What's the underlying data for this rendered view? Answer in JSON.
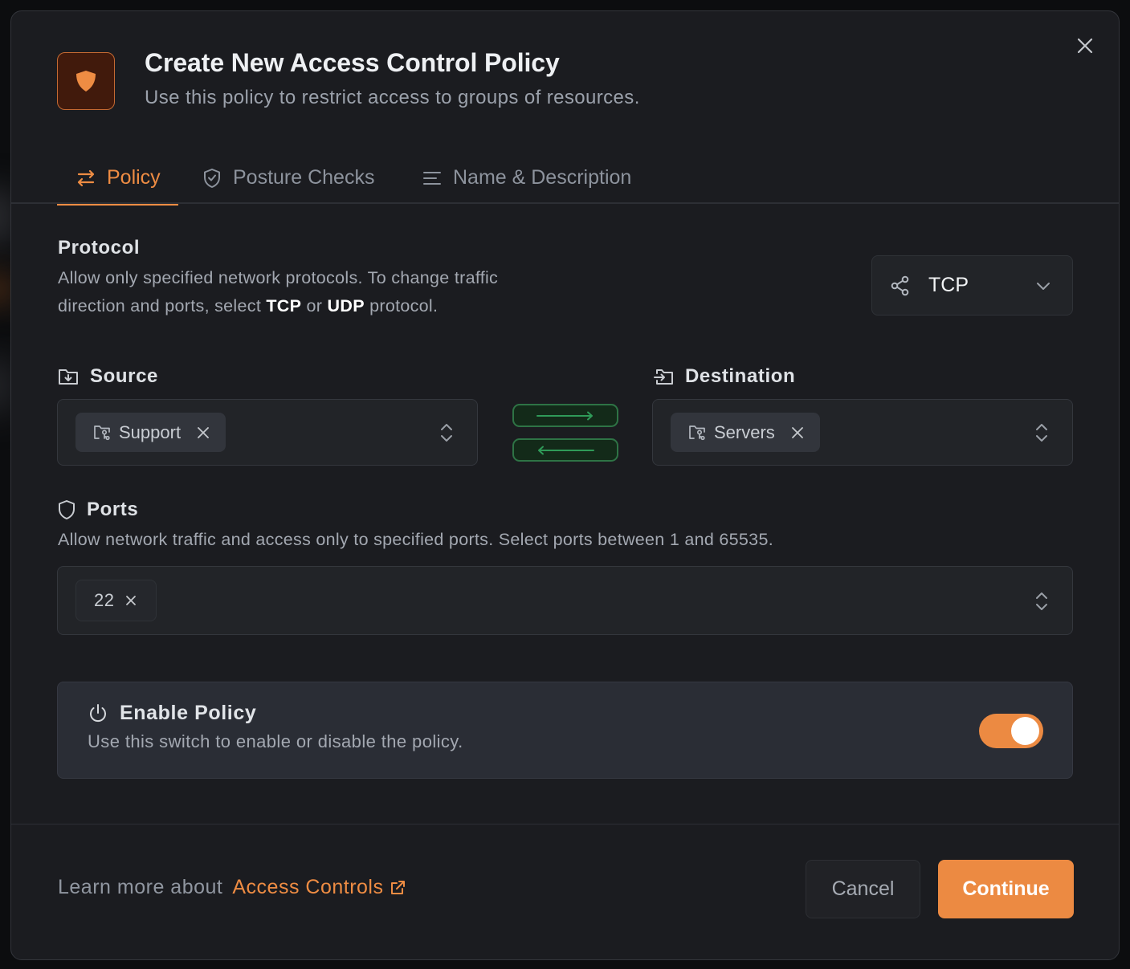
{
  "colors": {
    "accent": "#ec8a42",
    "dialog_bg": "#1b1c20",
    "direction_green": "#2e7345"
  },
  "dialog": {
    "title": "Create New Access Control Policy",
    "subtitle": "Use this policy to restrict access to groups of resources.",
    "header_icon": "shield-icon",
    "close_icon": "close-icon"
  },
  "tabs": [
    {
      "label": "Policy",
      "icon": "arrows-left-right-icon",
      "active": true
    },
    {
      "label": "Posture Checks",
      "icon": "shield-check-icon",
      "active": false
    },
    {
      "label": "Name & Description",
      "icon": "text-lines-icon",
      "active": false
    }
  ],
  "protocol": {
    "title": "Protocol",
    "desc_part1": "Allow only specified network protocols. To change traffic",
    "desc_part2": "direction and ports, select ",
    "desc_tcp": "TCP",
    "desc_or": " or ",
    "desc_udp": "UDP",
    "desc_end": " protocol.",
    "selected": "TCP",
    "icon": "share-icon"
  },
  "source": {
    "label": "Source",
    "icon": "folder-download-icon",
    "chips": [
      {
        "label": "Support",
        "icon": "folder-key-icon"
      }
    ]
  },
  "destination": {
    "label": "Destination",
    "icon": "folder-input-icon",
    "chips": [
      {
        "label": "Servers",
        "icon": "folder-key-icon"
      }
    ]
  },
  "direction": {
    "forward": "arrow-right-icon",
    "backward": "arrow-left-icon"
  },
  "ports": {
    "title": "Ports",
    "icon": "shield-icon",
    "desc": "Allow network traffic and access only to specified ports. Select ports between 1 and 65535.",
    "values": [
      "22"
    ]
  },
  "enable_policy": {
    "title": "Enable Policy",
    "desc": "Use this switch to enable or disable the policy.",
    "icon": "power-icon",
    "enabled": true
  },
  "footer": {
    "learn_prefix": "Learn more about",
    "learn_link": "Access Controls",
    "cancel_label": "Cancel",
    "continue_label": "Continue"
  }
}
